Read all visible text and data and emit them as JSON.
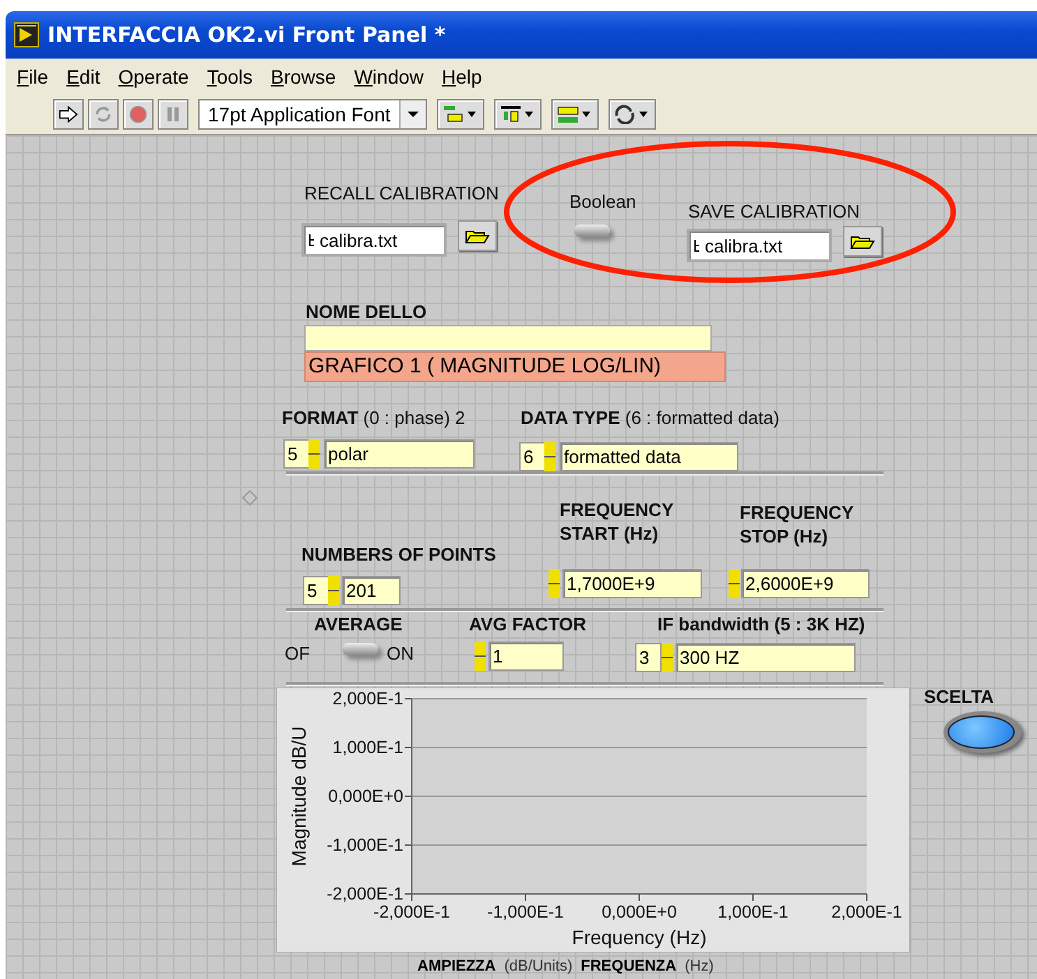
{
  "window": {
    "title": "INTERFACCIA OK2.vi Front Panel *"
  },
  "menu": [
    "File",
    "Edit",
    "Operate",
    "Tools",
    "Browse",
    "Window",
    "Help"
  ],
  "toolbar": {
    "font_menu": "17pt Application Font"
  },
  "recall_calibration": {
    "label": "RECALL CALIBRATION",
    "path": "calibra.txt"
  },
  "boolean_switch": {
    "label": "Boolean",
    "on": false
  },
  "save_calibration": {
    "label": "SAVE CALIBRATION",
    "path": "calibra.txt"
  },
  "graph_name": {
    "label": "NOME DELLO",
    "title": "GRAFICO 1 ( MAGNITUDE LOG/LIN)"
  },
  "format": {
    "label": "FORMAT",
    "note": "(0 : phase) 2",
    "index": "5",
    "value": "polar"
  },
  "data_type": {
    "label": "DATA TYPE",
    "note": "(6 : formatted data)",
    "index": "6",
    "value": "formatted data"
  },
  "frequency_start": {
    "label": "FREQUENCY START (Hz)",
    "value": "1,7000E+9"
  },
  "frequency_stop": {
    "label": "FREQUENCY STOP (Hz)",
    "value": "2,6000E+9"
  },
  "number_of_points": {
    "label": "NUMBERS OF POINTS",
    "index": "5",
    "value": "201"
  },
  "average": {
    "label": "AVERAGE",
    "off_label": "OF",
    "on_label": "ON",
    "on": false
  },
  "avg_factor": {
    "label": "AVG FACTOR",
    "value": "1"
  },
  "if_bandwidth": {
    "label": "IF bandwidth (5 : 3K HZ)",
    "index": "3",
    "value": "300 HZ"
  },
  "graph": {
    "axes": {
      "xlabel": "Frequency (Hz)",
      "ylabel": "Magnitude dB/U",
      "xticks": [
        "-2,000E-1",
        "-1,000E-1",
        "0,000E+0",
        "1,000E-1",
        "2,000E-1"
      ],
      "yticks": [
        "2,000E-1",
        "1,000E-1",
        "0,000E+0",
        "-1,000E-1",
        "-2,000E-1"
      ]
    },
    "legend": [
      {
        "kind": "name",
        "text": "AMPIEZZA"
      },
      {
        "kind": "unit",
        "text": "(dB/Units)"
      },
      {
        "kind": "name",
        "text": "FREQUENZA"
      },
      {
        "kind": "unit",
        "text": "(Hz)"
      }
    ]
  },
  "scelta": {
    "label": "SCELTA",
    "on": true
  }
}
